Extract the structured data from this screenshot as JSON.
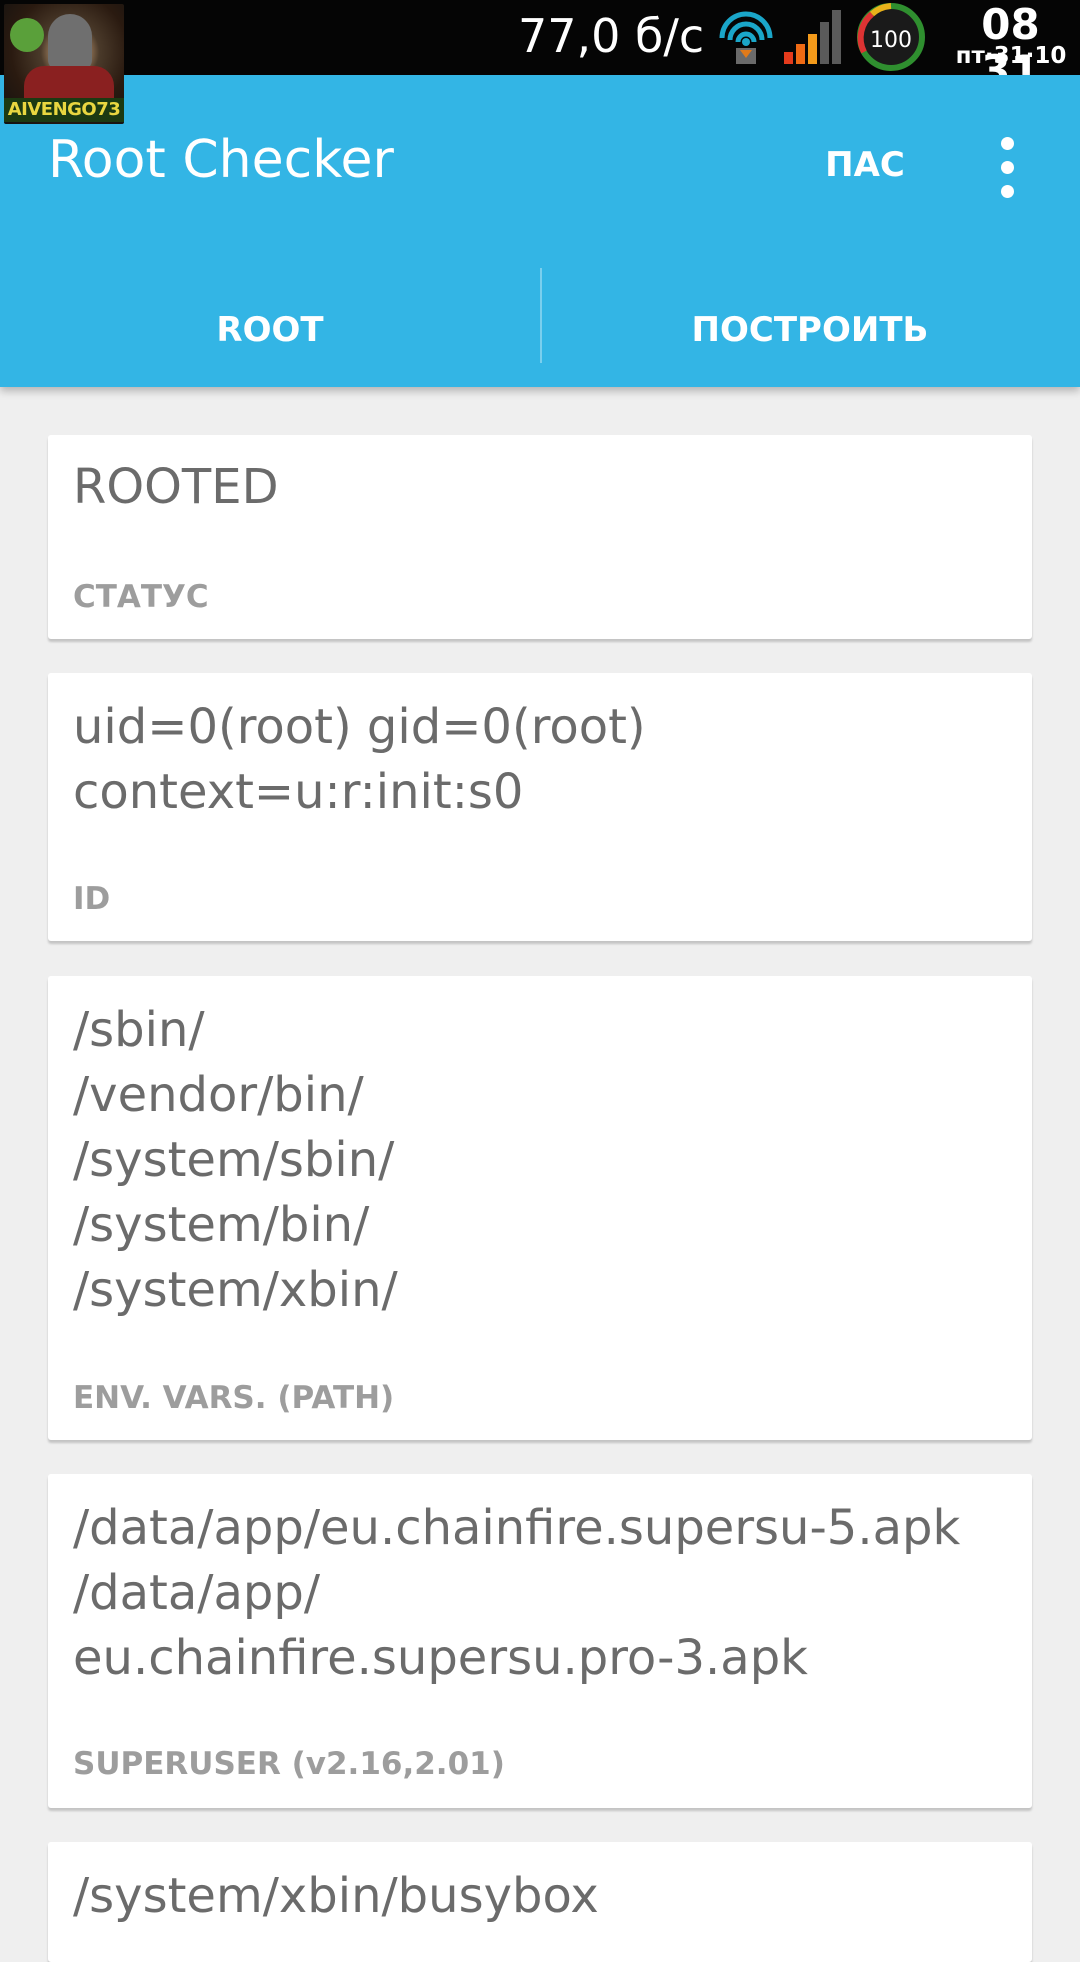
{
  "status_bar": {
    "avatar_tag": "AIVENGO73",
    "net_speed": "77,0 б/с",
    "wifi_icon": "wifi-icon",
    "signal_icon": "signal-strength-icon",
    "battery_level": "100",
    "time": "08 31",
    "date": "пт·31·10"
  },
  "app_bar": {
    "title": "Root Checker",
    "action_label": "ПАС",
    "overflow_icon": "overflow-menu-icon",
    "accent_color": "#33b5e5"
  },
  "tabs": [
    {
      "label": "ROOT"
    },
    {
      "label": "ПОСТРОИТЬ"
    }
  ],
  "cards": [
    {
      "value": "ROOTED",
      "label": "СТАТУС"
    },
    {
      "value": "uid=0(root) gid=0(root)\ncontext=u:r:init:s0",
      "label": "ID"
    },
    {
      "value": "/sbin/\n/vendor/bin/\n/system/sbin/\n/system/bin/\n/system/xbin/",
      "label": "ENV. VARS. (PATH)"
    },
    {
      "value": "/data/app/eu.chainfire.supersu-5.apk\n/data/app/\neu.chainfire.supersu.pro-3.apk",
      "label": "SUPERUSER (v2.16,2.01)"
    },
    {
      "value": "/system/xbin/busybox",
      "label": ""
    }
  ]
}
